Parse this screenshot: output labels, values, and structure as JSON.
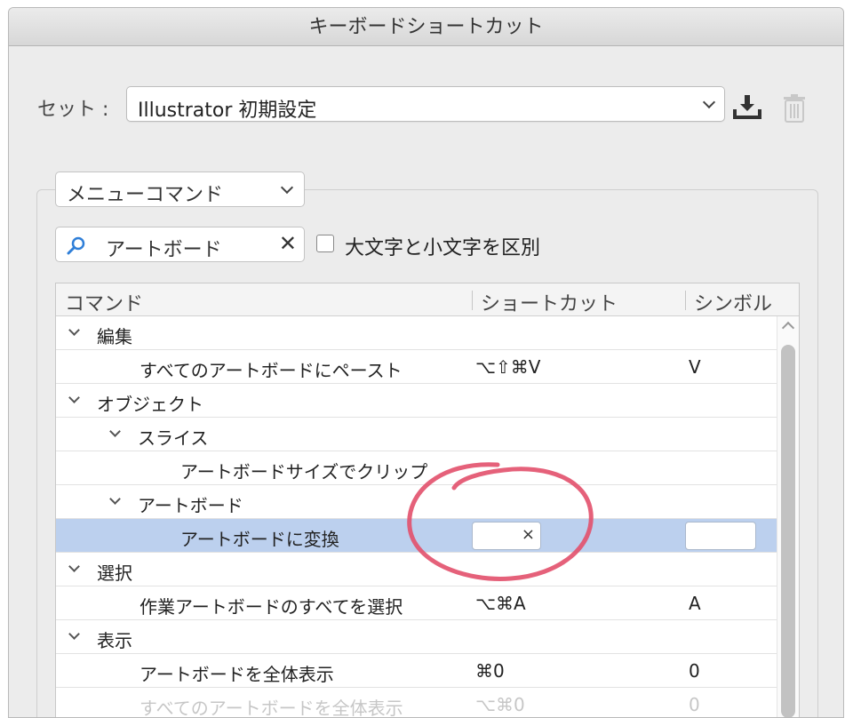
{
  "window": {
    "title": "キーボードショートカット"
  },
  "set": {
    "label": "セット :",
    "value": "Illustrator 初期設定"
  },
  "icons": {
    "save": "save-download-icon",
    "delete": "trash-icon",
    "search": "search-icon"
  },
  "filter": {
    "category": "メニューコマンド",
    "search_value": "アートボード",
    "clear_glyph": "✕",
    "case_label": "大文字と小文字を区別",
    "case_checked": false
  },
  "table": {
    "headers": {
      "command": "コマンド",
      "shortcut": "ショートカット",
      "symbol": "シンボル"
    },
    "rows": [
      {
        "level": 0,
        "expanded": true,
        "name": "編集",
        "shortcut": "",
        "symbol": ""
      },
      {
        "level": 2,
        "name": "すべてのアートボードにペースト",
        "shortcut": "⌥⇧⌘V",
        "symbol": "V"
      },
      {
        "level": 0,
        "expanded": true,
        "name": "オブジェクト",
        "shortcut": "",
        "symbol": ""
      },
      {
        "level": 1,
        "expanded": true,
        "name": "スライス",
        "shortcut": "",
        "symbol": ""
      },
      {
        "level": 3,
        "name": "アートボードサイズでクリップ",
        "shortcut": "",
        "symbol": ""
      },
      {
        "level": 1,
        "expanded": true,
        "name": "アートボード",
        "shortcut": "",
        "symbol": ""
      },
      {
        "level": 3,
        "name": "アートボードに変換",
        "shortcut": "",
        "symbol": "",
        "selected": true,
        "editing": true,
        "edit_clear": "×"
      },
      {
        "level": 0,
        "expanded": true,
        "name": "選択",
        "shortcut": "",
        "symbol": ""
      },
      {
        "level": 2,
        "name": "作業アートボードのすべてを選択",
        "shortcut": "⌥⌘A",
        "symbol": "A"
      },
      {
        "level": 0,
        "expanded": true,
        "name": "表示",
        "shortcut": "",
        "symbol": ""
      },
      {
        "level": 2,
        "name": "アートボードを全体表示",
        "shortcut": "⌘0",
        "symbol": "0"
      },
      {
        "level": 2,
        "name": "すべてのアートボードを全体表示",
        "shortcut": "⌥⌘0",
        "symbol": "0",
        "faded": true
      }
    ]
  },
  "colors": {
    "selection": "#bcd0ee",
    "annotation": "#e2506b",
    "accent": "#2f7fd8"
  }
}
